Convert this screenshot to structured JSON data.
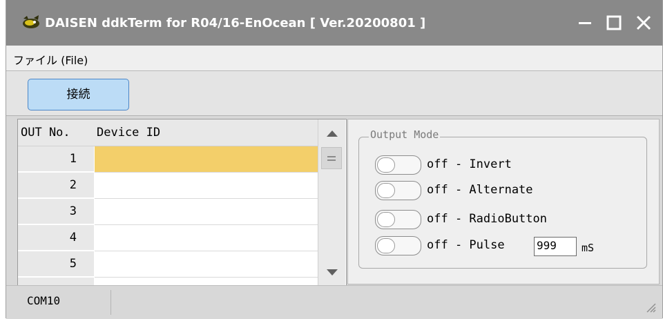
{
  "window": {
    "title": "DAISEN ddkTerm for R04/16-EnOcean [ Ver.20200801 ]",
    "icon": "dragon-app-icon",
    "controls": [
      "minimize-icon",
      "maximize-icon",
      "close-icon"
    ]
  },
  "menu": {
    "file_label": "ファイル (File)"
  },
  "toolbar": {
    "connect_label": "接続"
  },
  "grid": {
    "headers": {
      "out_no": "OUT No.",
      "device_id": "Device ID"
    },
    "rows": [
      {
        "num": "1",
        "device_id": "",
        "selected": true
      },
      {
        "num": "2",
        "device_id": ""
      },
      {
        "num": "3",
        "device_id": ""
      },
      {
        "num": "4",
        "device_id": ""
      },
      {
        "num": "5",
        "device_id": ""
      }
    ]
  },
  "output_mode": {
    "legend": "Output Mode",
    "modes": [
      {
        "label": "off - Invert",
        "state": "off"
      },
      {
        "label": "off - Alternate",
        "state": "off"
      },
      {
        "label": "off - RadioButton",
        "state": "off"
      },
      {
        "label": "off - Pulse",
        "state": "off"
      }
    ],
    "pulse_value": "999",
    "pulse_unit": "mS"
  },
  "status": {
    "port": "COM10"
  },
  "colors": {
    "titlebar": "#898989",
    "selected_row": "#f3cf6a",
    "connect_button": "#bcdcf6"
  }
}
